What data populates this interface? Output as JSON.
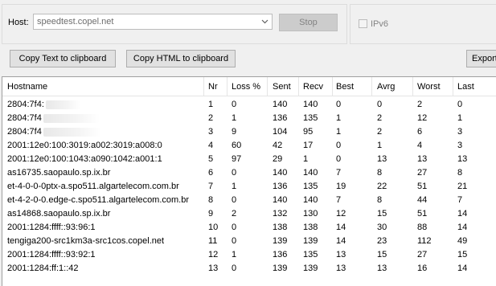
{
  "host": {
    "label": "Host:",
    "value": "speedtest.copel.net",
    "stop_label": "Stop",
    "ipv6_label": "IPv6"
  },
  "toolbar": {
    "copy_text_label": "Copy Text to clipboard",
    "copy_html_label": "Copy HTML to clipboard",
    "export_label": "Export"
  },
  "table": {
    "columns": [
      "Hostname",
      "Nr",
      "Loss %",
      "Sent",
      "Recv",
      "Best",
      "Avrg",
      "Worst",
      "Last"
    ],
    "rows": [
      [
        "2804:7f4:",
        "1",
        "0",
        "140",
        "140",
        "0",
        "0",
        "2",
        "0"
      ],
      [
        "2804:7f4",
        "2",
        "1",
        "136",
        "135",
        "1",
        "2",
        "12",
        "1"
      ],
      [
        "2804:7f4",
        "3",
        "9",
        "104",
        "95",
        "1",
        "2",
        "6",
        "3"
      ],
      [
        "2001:12e0:100:3019:a002:3019:a008:0",
        "4",
        "60",
        "42",
        "17",
        "0",
        "1",
        "4",
        "3"
      ],
      [
        "2001:12e0:100:1043:a090:1042:a001:1",
        "5",
        "97",
        "29",
        "1",
        "0",
        "13",
        "13",
        "13"
      ],
      [
        "as16735.saopaulo.sp.ix.br",
        "6",
        "0",
        "140",
        "140",
        "7",
        "8",
        "27",
        "8"
      ],
      [
        "et-4-0-0-0ptx-a.spo511.algartelecom.com.br",
        "7",
        "1",
        "136",
        "135",
        "19",
        "22",
        "51",
        "21"
      ],
      [
        "et-4-2-0-0.edge-c.spo511.algartelecom.com.br",
        "8",
        "0",
        "140",
        "140",
        "7",
        "8",
        "44",
        "7"
      ],
      [
        "as14868.saopaulo.sp.ix.br",
        "9",
        "2",
        "132",
        "130",
        "12",
        "15",
        "51",
        "14"
      ],
      [
        "2001:1284:ffff::93:96:1",
        "10",
        "0",
        "138",
        "138",
        "14",
        "30",
        "88",
        "14"
      ],
      [
        "tengiga200-src1km3a-src1cos.copel.net",
        "11",
        "0",
        "139",
        "139",
        "14",
        "23",
        "112",
        "49"
      ],
      [
        "2001:1284:ffff::93:92:1",
        "12",
        "1",
        "136",
        "135",
        "13",
        "15",
        "27",
        "15"
      ],
      [
        "2001:1284:ff:1::42",
        "13",
        "0",
        "139",
        "139",
        "13",
        "13",
        "16",
        "14"
      ]
    ]
  }
}
